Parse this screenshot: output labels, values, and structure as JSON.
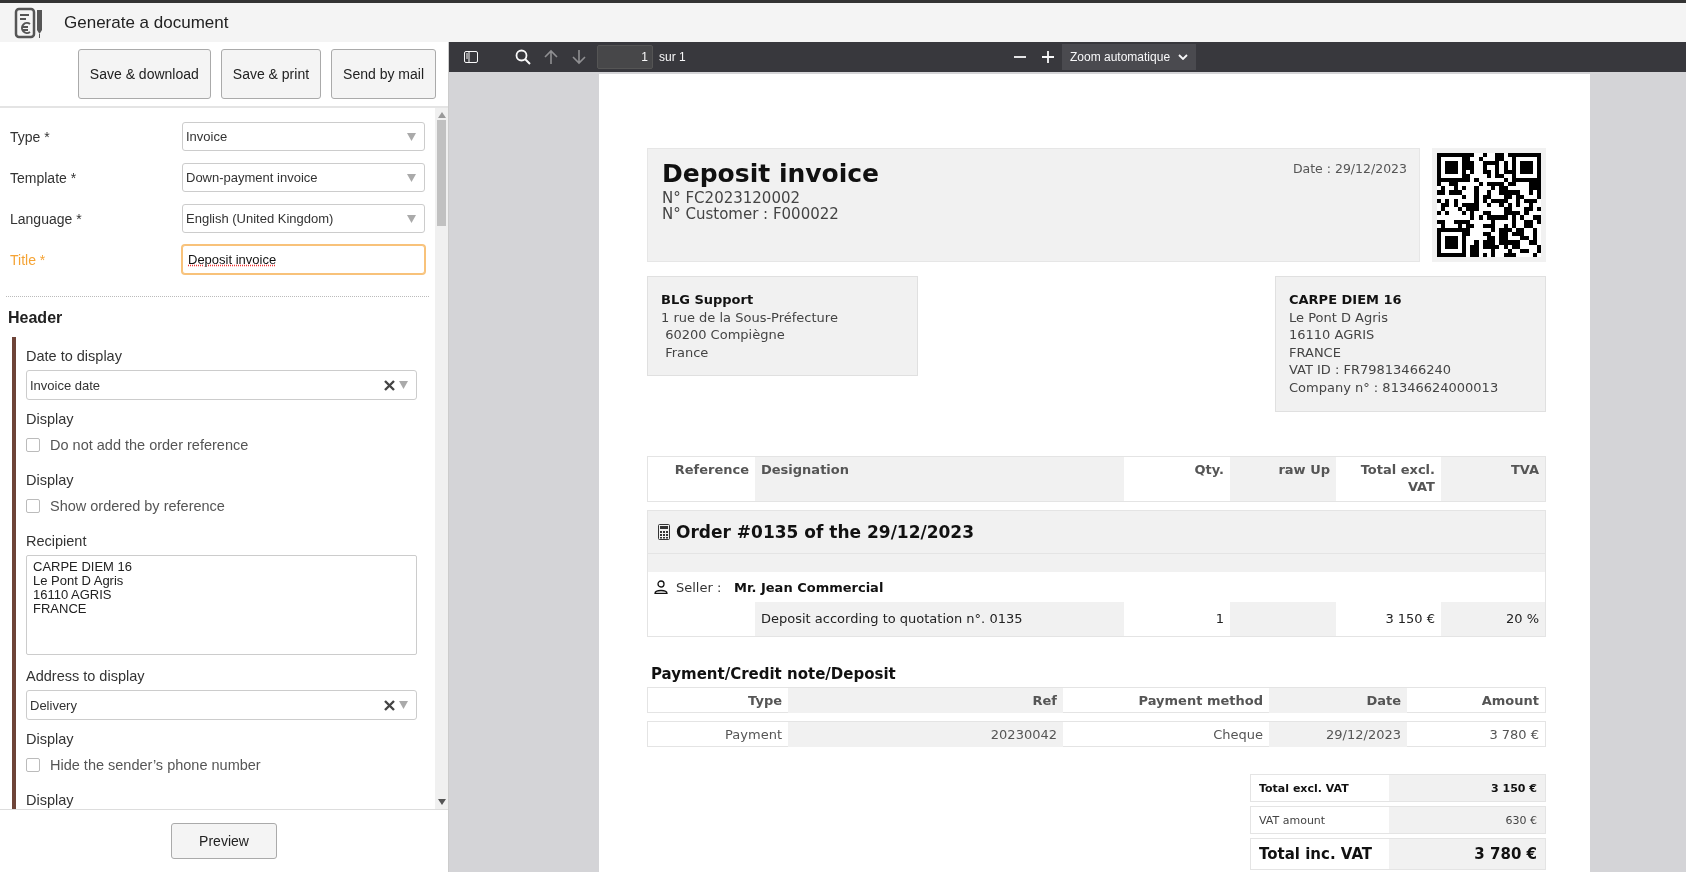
{
  "app": {
    "title": "Generate a document"
  },
  "actions": [
    {
      "label": "Save & download"
    },
    {
      "label": "Save & print"
    },
    {
      "label": "Send by mail"
    }
  ],
  "fields": [
    {
      "kind": "select",
      "label": "Type *",
      "value": "Invoice",
      "focused": false
    },
    {
      "kind": "select",
      "label": "Template *",
      "value": "Down-payment invoice",
      "focused": false
    },
    {
      "kind": "select",
      "label": "Language *",
      "value": "English (United Kingdom)",
      "focused": false
    },
    {
      "kind": "text",
      "label": "Title *",
      "value": "Deposit invoice",
      "focused": true
    }
  ],
  "header_section": {
    "title": "Header",
    "items": [
      {
        "kind": "clearable",
        "label": "Date to display",
        "value": "Invoice date"
      },
      {
        "kind": "checkbox",
        "label": "Display",
        "option": "Do not add the order reference",
        "checked": false
      },
      {
        "kind": "checkbox",
        "label": "Display",
        "option": "Show ordered by reference",
        "checked": false
      },
      {
        "kind": "textarea",
        "label": "Recipient",
        "value": "CARPE DIEM 16\nLe Pont D Agris\n16110 AGRIS\nFRANCE"
      },
      {
        "kind": "clearable",
        "label": "Address to display",
        "value": "Delivery"
      },
      {
        "kind": "checkbox",
        "label": "Display",
        "option": "Hide the sender’s phone number",
        "checked": false
      },
      {
        "kind": "label",
        "label": "Display"
      }
    ]
  },
  "footer": {
    "button": "Preview"
  },
  "viewer": {
    "page": "1",
    "page_total": "sur 1",
    "zoom": "Zoom automatique"
  },
  "document": {
    "title": "Deposit invoice",
    "numbers": [
      "N° FC2023120002",
      "N° Customer : F000022"
    ],
    "date": "Date : 29/12/2023",
    "sender": {
      "name": "BLG Support",
      "lines": [
        "1 rue de la Sous-Préfecture",
        " 60200 Compiègne",
        " France"
      ]
    },
    "recipient": {
      "name": "CARPE DIEM 16",
      "lines": [
        "Le Pont D Agris",
        "16110 AGRIS",
        "FRANCE",
        "VAT ID : FR79813466240",
        "Company n° : 81346624000013"
      ]
    },
    "items": {
      "columns": [
        "Reference",
        "Designation",
        "Qty.",
        "raw Up",
        "Total excl.\nVAT",
        "TVA"
      ],
      "group": "Order #0135 of the 29/12/2023",
      "seller_label": "Seller :",
      "seller": "Mr. Jean Commercial",
      "rows": [
        [
          "",
          "Deposit according to quotation n°. 0135",
          "1",
          "",
          "3 150 €",
          "20 %"
        ]
      ]
    },
    "payments": {
      "title": "Payment/Credit note/Deposit",
      "columns": [
        "Type",
        "Ref",
        "Payment method",
        "Date",
        "Amount"
      ],
      "rows": [
        [
          "Payment",
          "20230042",
          "Cheque",
          "29/12/2023",
          "3 780 €"
        ]
      ]
    },
    "totals": [
      {
        "kind": "bold",
        "label": "Total excl. VAT",
        "value": "3 150 €"
      },
      {
        "kind": "normal",
        "label": "VAT amount",
        "value": "630 €"
      },
      {
        "kind": "grand",
        "label": "Total inc. VAT",
        "value": "3 780 €"
      }
    ]
  }
}
